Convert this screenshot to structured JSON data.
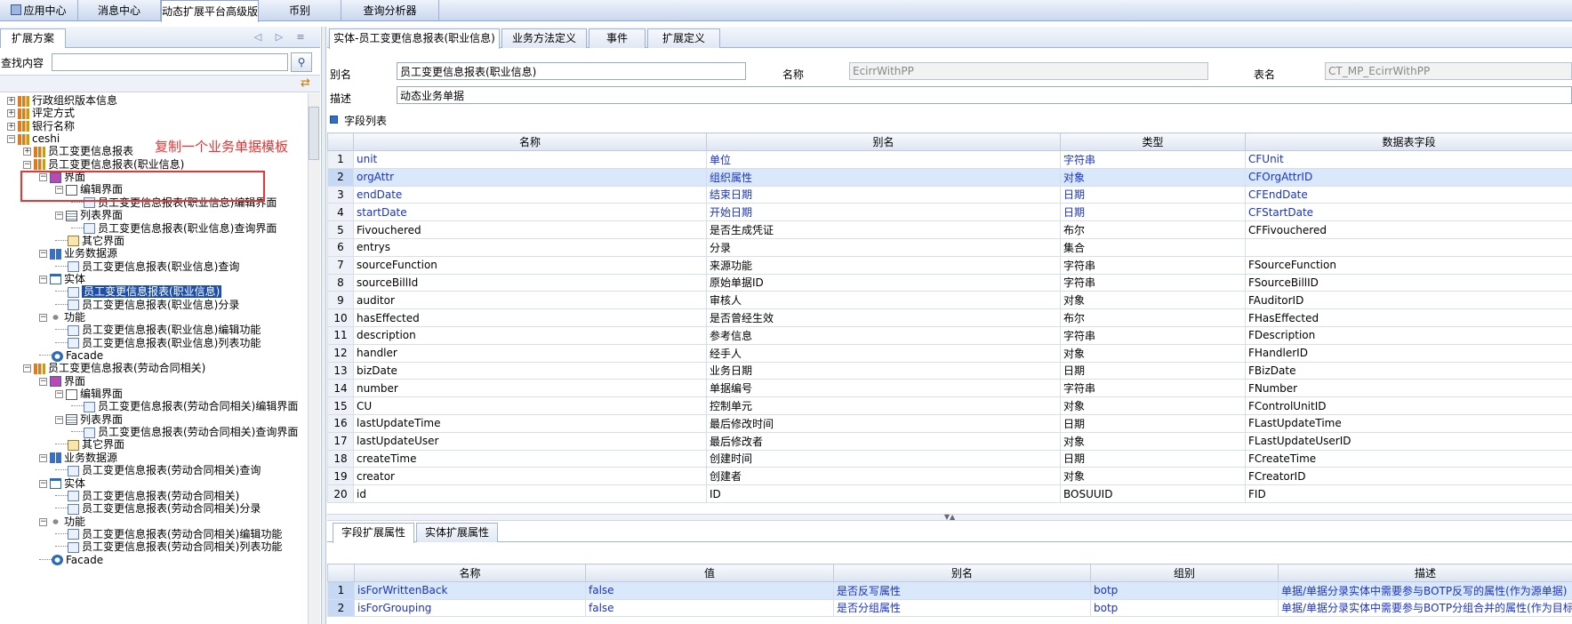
{
  "top_tabs": [
    {
      "label": "应用中心"
    },
    {
      "label": "消息中心"
    },
    {
      "label": "动态扩展平台高级版"
    },
    {
      "label": "币别"
    },
    {
      "label": "查询分析器"
    }
  ],
  "left_panel": {
    "tab_label": "扩展方案",
    "search_label": "查找内容",
    "search_value": "",
    "tree": [
      {
        "label": "行政组织版本信息",
        "icon": "report-icon",
        "toggle": "+"
      },
      {
        "label": "评定方式",
        "icon": "report-icon",
        "toggle": "+"
      },
      {
        "label": "银行名称",
        "icon": "report-icon",
        "toggle": "+"
      },
      {
        "label": "ceshi",
        "icon": "report-icon",
        "toggle": "-"
      },
      {
        "label": "员工变更信息报表",
        "icon": "report-icon",
        "toggle": "+"
      },
      {
        "label": "员工变更信息报表(职业信息)",
        "icon": "report-icon",
        "toggle": "-"
      },
      {
        "label": "界面",
        "icon": "ui-icon",
        "toggle": "-"
      },
      {
        "label": "编辑界面",
        "icon": "form-icon",
        "toggle": "-"
      },
      {
        "label": "员工变更信息报表(职业信息)编辑界面",
        "icon": "doc-icon",
        "toggle": ""
      },
      {
        "label": "列表界面",
        "icon": "list-icon",
        "toggle": "-"
      },
      {
        "label": "员工变更信息报表(职业信息)查询界面",
        "icon": "doc-icon",
        "toggle": ""
      },
      {
        "label": "其它界面",
        "icon": "other-icon",
        "toggle": ""
      },
      {
        "label": "业务数据源",
        "icon": "datasource-icon",
        "toggle": "-"
      },
      {
        "label": "员工变更信息报表(职业信息)查询",
        "icon": "doc-icon",
        "toggle": ""
      },
      {
        "label": "实体",
        "icon": "entity-icon",
        "toggle": "-"
      },
      {
        "label": "员工变更信息报表(职业信息)",
        "icon": "doc-icon",
        "toggle": "",
        "selected": true
      },
      {
        "label": "员工变更信息报表(职业信息)分录",
        "icon": "doc-icon",
        "toggle": ""
      },
      {
        "label": "功能",
        "icon": "function-icon",
        "toggle": "-"
      },
      {
        "label": "员工变更信息报表(职业信息)编辑功能",
        "icon": "doc-icon",
        "toggle": ""
      },
      {
        "label": "员工变更信息报表(职业信息)列表功能",
        "icon": "doc-icon",
        "toggle": ""
      },
      {
        "label": "Facade",
        "icon": "facade-icon",
        "toggle": ""
      },
      {
        "label": "员工变更信息报表(劳动合同相关)",
        "icon": "report-icon",
        "toggle": "-"
      },
      {
        "label": "界面",
        "icon": "ui-icon",
        "toggle": "-"
      },
      {
        "label": "编辑界面",
        "icon": "form-icon",
        "toggle": "-"
      },
      {
        "label": "员工变更信息报表(劳动合同相关)编辑界面",
        "icon": "doc-icon",
        "toggle": ""
      },
      {
        "label": "列表界面",
        "icon": "list-icon",
        "toggle": "-"
      },
      {
        "label": "员工变更信息报表(劳动合同相关)查询界面",
        "icon": "doc-icon",
        "toggle": ""
      },
      {
        "label": "其它界面",
        "icon": "other-icon",
        "toggle": ""
      },
      {
        "label": "业务数据源",
        "icon": "datasource-icon",
        "toggle": "-"
      },
      {
        "label": "员工变更信息报表(劳动合同相关)查询",
        "icon": "doc-icon",
        "toggle": ""
      },
      {
        "label": "实体",
        "icon": "entity-icon",
        "toggle": "-"
      },
      {
        "label": "员工变更信息报表(劳动合同相关)",
        "icon": "doc-icon",
        "toggle": ""
      },
      {
        "label": "员工变更信息报表(劳动合同相关)分录",
        "icon": "doc-icon",
        "toggle": ""
      },
      {
        "label": "功能",
        "icon": "function-icon",
        "toggle": "-"
      },
      {
        "label": "员工变更信息报表(劳动合同相关)编辑功能",
        "icon": "doc-icon",
        "toggle": ""
      },
      {
        "label": "员工变更信息报表(劳动合同相关)列表功能",
        "icon": "doc-icon",
        "toggle": ""
      },
      {
        "label": "Facade",
        "icon": "facade-icon",
        "toggle": ""
      }
    ],
    "annotation": "复制一个业务单据模板"
  },
  "right_panel": {
    "tabs": [
      "实体-员工变更信息报表(职业信息)",
      "业务方法定义",
      "事件",
      "扩展定义"
    ],
    "fields": {
      "alias_label": "别名",
      "alias_value": "员工变更信息报表(职业信息)",
      "name_label": "名称",
      "name_value": "EcirrWithPP",
      "table_label": "表名",
      "table_value": "CT_MP_EcirrWithPP",
      "desc_label": "描述",
      "desc_value": "动态业务单据"
    },
    "section_title": "字段列表",
    "columns": [
      "名称",
      "别名",
      "类型",
      "数据表字段"
    ],
    "rows": [
      {
        "n": "1",
        "name": "unit",
        "alias": "单位",
        "type": "字符串",
        "col": "CFUnit",
        "ext": true
      },
      {
        "n": "2",
        "name": "orgAttr",
        "alias": "组织属性",
        "type": "对象",
        "col": "CFOrgAttrID",
        "ext": true
      },
      {
        "n": "3",
        "name": "endDate",
        "alias": "结束日期",
        "type": "日期",
        "col": "CFEndDate",
        "ext": true
      },
      {
        "n": "4",
        "name": "startDate",
        "alias": "开始日期",
        "type": "日期",
        "col": "CFStartDate",
        "ext": true
      },
      {
        "n": "5",
        "name": "Fivouchered",
        "alias": "是否生成凭证",
        "type": "布尔",
        "col": "CFFivouchered",
        "ext": false
      },
      {
        "n": "6",
        "name": "entrys",
        "alias": "分录",
        "type": "集合",
        "col": "",
        "ext": false
      },
      {
        "n": "7",
        "name": "sourceFunction",
        "alias": "来源功能",
        "type": "字符串",
        "col": "FSourceFunction",
        "ext": false
      },
      {
        "n": "8",
        "name": "sourceBillId",
        "alias": "原始单据ID",
        "type": "字符串",
        "col": "FSourceBillID",
        "ext": false
      },
      {
        "n": "9",
        "name": "auditor",
        "alias": "审核人",
        "type": "对象",
        "col": "FAuditorID",
        "ext": false
      },
      {
        "n": "10",
        "name": "hasEffected",
        "alias": "是否曾经生效",
        "type": "布尔",
        "col": "FHasEffected",
        "ext": false
      },
      {
        "n": "11",
        "name": "description",
        "alias": "参考信息",
        "type": "字符串",
        "col": "FDescription",
        "ext": false
      },
      {
        "n": "12",
        "name": "handler",
        "alias": "经手人",
        "type": "对象",
        "col": "FHandlerID",
        "ext": false
      },
      {
        "n": "13",
        "name": "bizDate",
        "alias": "业务日期",
        "type": "日期",
        "col": "FBizDate",
        "ext": false
      },
      {
        "n": "14",
        "name": "number",
        "alias": "单据编号",
        "type": "字符串",
        "col": "FNumber",
        "ext": false
      },
      {
        "n": "15",
        "name": "CU",
        "alias": "控制单元",
        "type": "对象",
        "col": "FControlUnitID",
        "ext": false
      },
      {
        "n": "16",
        "name": "lastUpdateTime",
        "alias": "最后修改时间",
        "type": "日期",
        "col": "FLastUpdateTime",
        "ext": false
      },
      {
        "n": "17",
        "name": "lastUpdateUser",
        "alias": "最后修改者",
        "type": "对象",
        "col": "FLastUpdateUserID",
        "ext": false
      },
      {
        "n": "18",
        "name": "createTime",
        "alias": "创建时间",
        "type": "日期",
        "col": "FCreateTime",
        "ext": false
      },
      {
        "n": "19",
        "name": "creator",
        "alias": "创建者",
        "type": "对象",
        "col": "FCreatorID",
        "ext": false
      },
      {
        "n": "20",
        "name": "id",
        "alias": "ID",
        "type": "BOSUUID",
        "col": "FID",
        "ext": false
      }
    ],
    "bottom_tabs": [
      "字段扩展属性",
      "实体扩展属性"
    ],
    "bottom_columns": [
      "名称",
      "值",
      "别名",
      "组别",
      "描述"
    ],
    "bottom_rows": [
      {
        "n": "1",
        "name": "isForWrittenBack",
        "value": "false",
        "alias": "是否反写属性",
        "group": "botp",
        "desc": "单据/单据分录实体中需要参与BOTP反写的属性(作为源单据)"
      },
      {
        "n": "2",
        "name": "isForGrouping",
        "value": "false",
        "alias": "是否分组属性",
        "group": "botp",
        "desc": "单据/单据分录实体中需要参与BOTP分组合并的属性(作为目标"
      }
    ]
  }
}
